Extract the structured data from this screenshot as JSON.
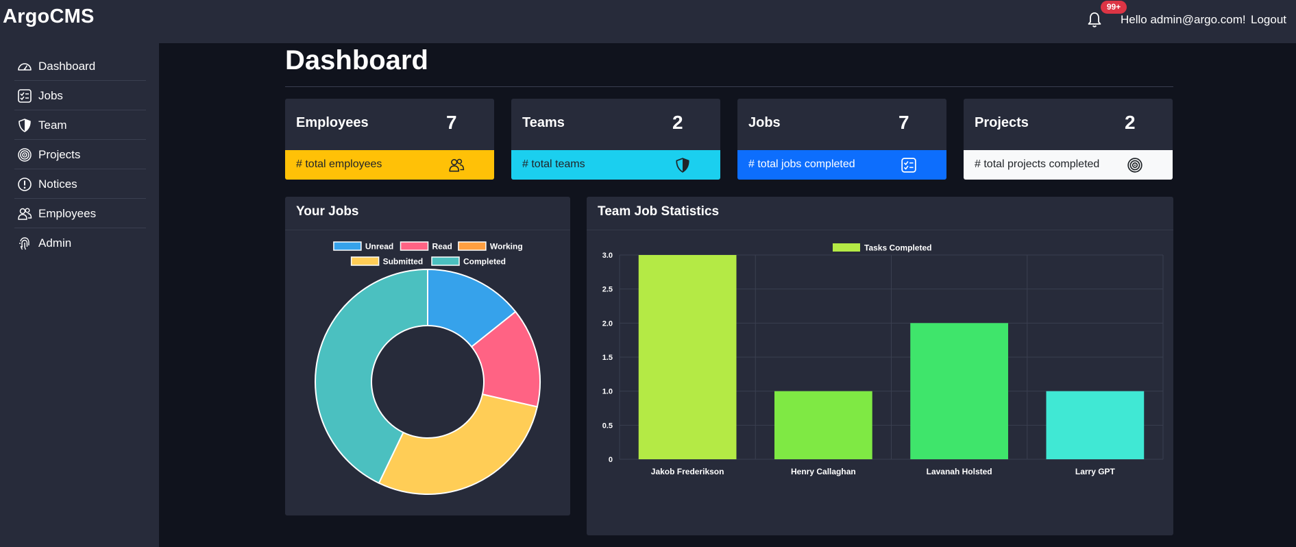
{
  "app": {
    "brand": "ArgoCMS"
  },
  "header": {
    "notification_badge": "99+",
    "greeting": "Hello admin@argo.com!",
    "logout_label": "Logout"
  },
  "sidebar": {
    "items": [
      {
        "label": "Dashboard",
        "icon": "speedometer-icon"
      },
      {
        "label": "Jobs",
        "icon": "checklist-icon"
      },
      {
        "label": "Team",
        "icon": "shield-icon"
      },
      {
        "label": "Projects",
        "icon": "target-icon"
      },
      {
        "label": "Notices",
        "icon": "alert-icon"
      },
      {
        "label": "Employees",
        "icon": "people-icon"
      },
      {
        "label": "Admin",
        "icon": "fingerprint-icon"
      }
    ]
  },
  "main": {
    "title": "Dashboard",
    "stats": [
      {
        "label": "Employees",
        "value": "7",
        "footer": "# total employees",
        "icon": "people-icon",
        "color": "#ffc107",
        "text_color": "#212529"
      },
      {
        "label": "Teams",
        "value": "2",
        "footer": "# total teams",
        "icon": "shield-icon",
        "color": "#1bcfef",
        "text_color": "#212529"
      },
      {
        "label": "Jobs",
        "value": "7",
        "footer": "# total jobs completed",
        "icon": "checklist-icon",
        "color": "#0d6efd",
        "text_color": "#ffffff"
      },
      {
        "label": "Projects",
        "value": "2",
        "footer": "# total projects completed",
        "icon": "target-icon",
        "color": "#f8f9fa",
        "text_color": "#212529"
      }
    ],
    "your_jobs_title": "Your Jobs",
    "team_stats_title": "Team Job Statistics"
  },
  "chart_data": [
    {
      "type": "pie",
      "variant": "doughnut",
      "labels": [
        "Unread",
        "Read",
        "Working",
        "Submitted",
        "Completed"
      ],
      "values": [
        1,
        1,
        0,
        2,
        3
      ],
      "colors": [
        "#36a2eb",
        "#ff6384",
        "#ff9f40",
        "#ffcd56",
        "#4bc0c0"
      ],
      "legend": "top"
    },
    {
      "type": "bar",
      "categories": [
        "Jakob Frederikson",
        "Henry Callaghan",
        "Lavanah Holsted",
        "Larry GPT"
      ],
      "series": [
        {
          "name": "Tasks Completed",
          "values": [
            3,
            1,
            2,
            1
          ]
        }
      ],
      "bar_colors": [
        "#b4ea45",
        "#7fe944",
        "#3fe56b",
        "#40e8d4"
      ],
      "legend_color": "#b4ea45",
      "yticks": [
        "0",
        "0.5",
        "1.0",
        "1.5",
        "2.0",
        "2.5",
        "3.0"
      ],
      "ylim": [
        0,
        3
      ],
      "grid": true,
      "legend": "top"
    }
  ]
}
